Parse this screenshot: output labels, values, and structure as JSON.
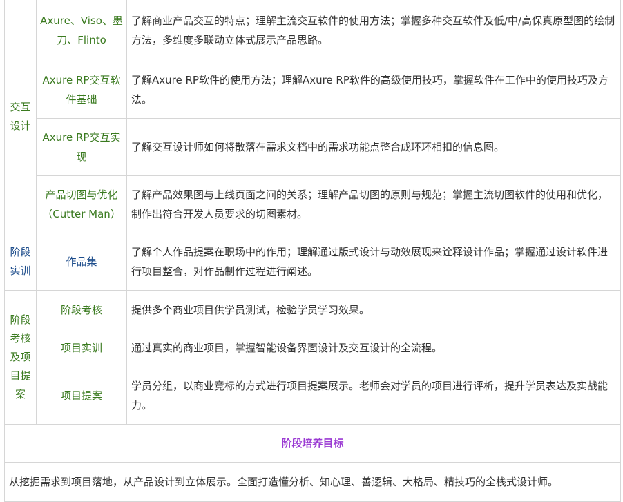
{
  "rows": {
    "interaction": {
      "stage": "交互设计",
      "courses": [
        {
          "name": "Axure、Viso、墨刀、Flinto",
          "desc": "了解商业产品交互的特点；理解主流交互软件的使用方法；掌握多种交互软件及低/中/高保真原型图的绘制方法，多维度多联动立体式展示产品思路。"
        },
        {
          "name": "Axure RP交互软件基础",
          "desc": "了解Axure RP软件的使用方法；理解Axure RP软件的高级使用技巧，掌握软件在工作中的使用技巧及方法。"
        },
        {
          "name": "Axure RP交互实现",
          "desc": "了解交互设计师如何将散落在需求文档中的需求功能点整合成环环相扣的信息图。"
        },
        {
          "name": "产品切图与优化（Cutter Man）",
          "desc": "了解产品效果图与上线页面之间的关系；理解产品切图的原则与规范；掌握主流切图软件的使用和优化，制作出符合开发人员要求的切图素材。"
        }
      ]
    },
    "training": {
      "stage": "阶段实训",
      "courses": [
        {
          "name": "作品集",
          "desc": "了解个人作品提案在职场中的作用；理解通过版式设计与动效展现来诠释设计作品；掌握通过设计软件进行项目整合，对作品制作过程进行阐述。"
        }
      ]
    },
    "assessment": {
      "stage": "阶段考核及项目提案",
      "courses": [
        {
          "name": "阶段考核",
          "desc": "提供多个商业项目供学员测试，检验学员学习效果。"
        },
        {
          "name": "项目实训",
          "desc": "通过真实的商业项目，掌握智能设备界面设计及交互设计的全流程。"
        },
        {
          "name": "项目提案",
          "desc": "学员分组，以商业竞标的方式进行项目提案展示。老师会对学员的项目进行评析，提升学员表达及实战能力。"
        }
      ]
    }
  },
  "goal": {
    "title": "阶段培养目标",
    "text": "从挖掘需求到项目落地，从产品设计到立体展示。全面打造懂分析、知心理、善逻辑、大格局、精技巧的全栈式设计师。"
  },
  "colors": {
    "course_green": "#3a7a1f",
    "stage_blue": "#1f4e8c",
    "goal_purple": "#9b3bd3",
    "border": "#d6d6d6"
  }
}
